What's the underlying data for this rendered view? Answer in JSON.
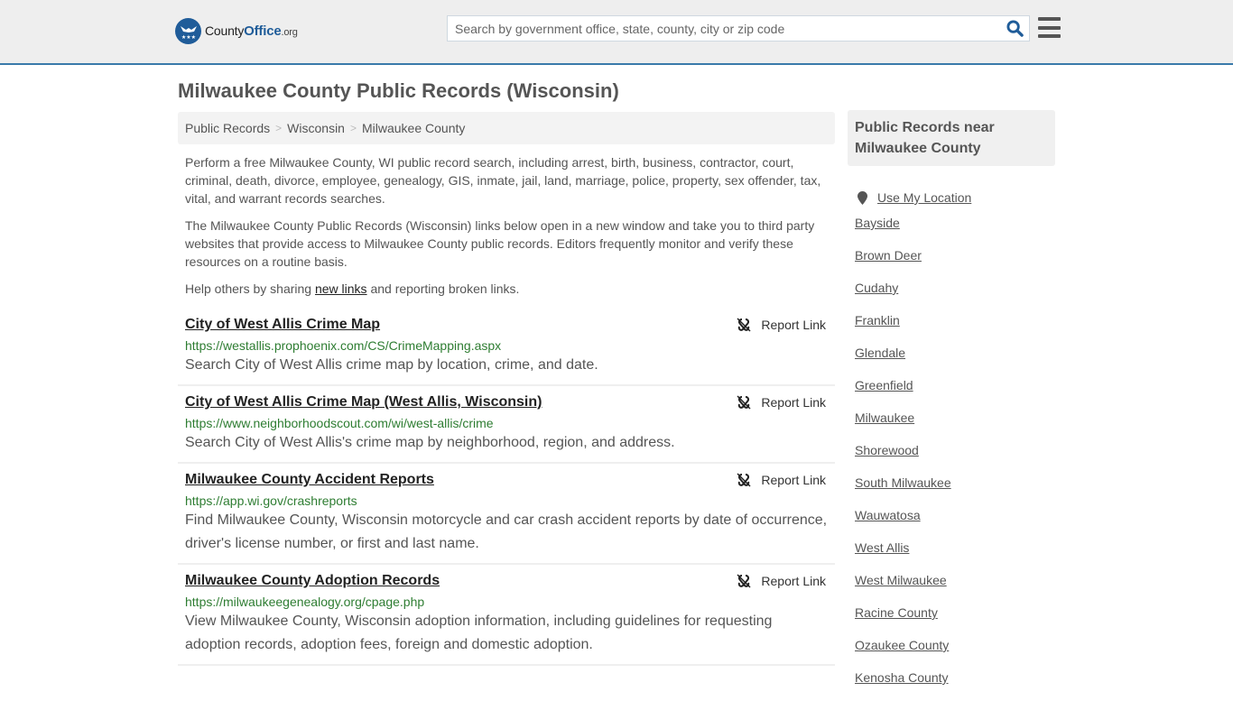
{
  "header": {
    "logo": {
      "name": "County",
      "name_bold": "Office",
      "tld": ".org"
    },
    "search_placeholder": "Search by government office, state, county, city or zip code",
    "colors": {
      "brand": "#1f5c99",
      "accent_border": "#3a7aaa"
    }
  },
  "page_title": "Milwaukee County Public Records (Wisconsin)",
  "breadcrumb": [
    {
      "label": "Public Records"
    },
    {
      "label": "Wisconsin"
    },
    {
      "label": "Milwaukee County"
    }
  ],
  "intro": {
    "p1": "Perform a free Milwaukee County, WI public record search, including arrest, birth, business, contractor, court, criminal, death, divorce, employee, genealogy, GIS, inmate, jail, land, marriage, police, property, sex offender, tax, vital, and warrant records searches.",
    "p2": "The Milwaukee County Public Records (Wisconsin) links below open in a new window and take you to third party websites that provide access to Milwaukee County public records. Editors frequently monitor and verify these resources on a routine basis.",
    "p3_before": "Help others by sharing ",
    "p3_link": "new links",
    "p3_after": " and reporting broken links."
  },
  "report_label": "Report Link",
  "records": [
    {
      "title": "City of West Allis Crime Map",
      "url": "https://westallis.prophoenix.com/CS/CrimeMapping.aspx",
      "desc": "Search City of West Allis crime map by location, crime, and date."
    },
    {
      "title": "City of West Allis Crime Map (West Allis, Wisconsin)",
      "url": "https://www.neighborhoodscout.com/wi/west-allis/crime",
      "desc": "Search City of West Allis's crime map by neighborhood, region, and address."
    },
    {
      "title": "Milwaukee County Accident Reports",
      "url": "https://app.wi.gov/crashreports",
      "desc": "Find Milwaukee County, Wisconsin motorcycle and car crash accident reports by date of occurrence, driver's license number, or first and last name."
    },
    {
      "title": "Milwaukee County Adoption Records",
      "url": "https://milwaukeegenealogy.org/cpage.php",
      "desc": "View Milwaukee County, Wisconsin adoption information, including guidelines for requesting adoption records, adoption fees, foreign and domestic adoption."
    }
  ],
  "sidebar": {
    "title": "Public Records near Milwaukee County",
    "use_location": "Use My Location",
    "places": [
      "Bayside",
      "Brown Deer",
      "Cudahy",
      "Franklin",
      "Glendale",
      "Greenfield",
      "Milwaukee",
      "Shorewood",
      "South Milwaukee",
      "Wauwatosa",
      "West Allis",
      "West Milwaukee",
      "Racine County",
      "Ozaukee County",
      "Kenosha County"
    ]
  }
}
